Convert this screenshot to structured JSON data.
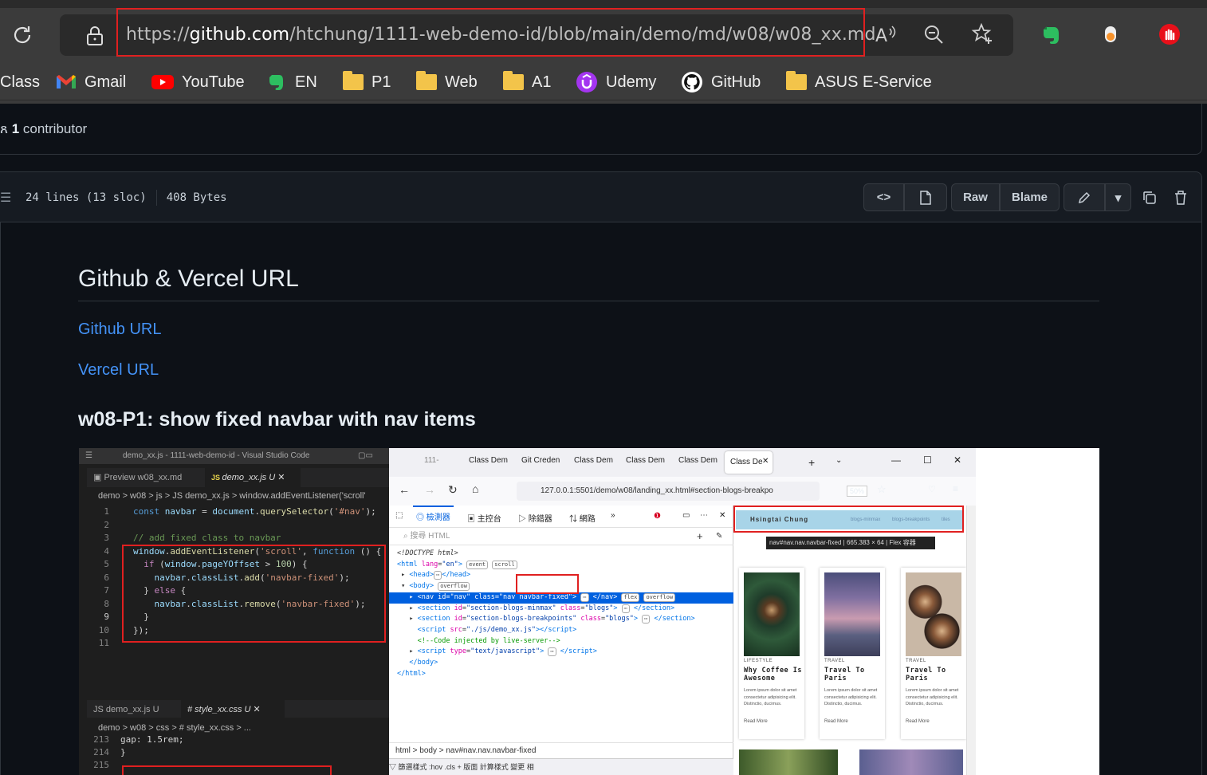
{
  "browser": {
    "url": {
      "prefix": "https://",
      "domain": "github.com",
      "path": "/htchung/1111-web-demo-id/blob/main/demo/md/w08/w08_xx.md"
    },
    "bookmarks": [
      {
        "label": "Class",
        "icon": "none"
      },
      {
        "label": "Gmail",
        "icon": "gmail-icon"
      },
      {
        "label": "YouTube",
        "icon": "youtube-icon"
      },
      {
        "label": "EN",
        "icon": "evernote-icon"
      },
      {
        "label": "P1",
        "icon": "folder-icon"
      },
      {
        "label": "Web",
        "icon": "folder-icon"
      },
      {
        "label": "A1",
        "icon": "folder-icon"
      },
      {
        "label": "Udemy",
        "icon": "udemy-icon"
      },
      {
        "label": "GitHub",
        "icon": "github-icon"
      },
      {
        "label": "ASUS E-Service",
        "icon": "folder-icon"
      }
    ]
  },
  "file": {
    "contributors": "1",
    "contributors_label": "contributor",
    "lines": "24 lines (13 sloc)",
    "size": "408 Bytes",
    "raw_label": "Raw",
    "blame_label": "Blame"
  },
  "markdown": {
    "h1": "Github & Vercel URL",
    "link1": "Github URL",
    "link2": "Vercel URL",
    "h3": "w08-P1: show fixed navbar with nav items"
  },
  "screenshot": {
    "vscode": {
      "title": "demo_xx.js - 1111-web-demo-id - Visual Studio Code",
      "tab1": "Preview w08_xx.md",
      "tab2": "demo_xx.js U",
      "breadcrumb": "demo > w08 > js > JS demo_xx.js > window.addEventListener('scroll'",
      "tab3": "JS demo_xx.js U",
      "tab4": "# style_xx.css U",
      "breadcrumb2": "demo > w08 > css > # style_xx.css > ...",
      "code2_213": "gap: 1.5rem;",
      "code2_214": "}"
    },
    "firefox": {
      "tabs": [
        "111-",
        "Class Dem",
        "Git Creden",
        "Class Dem",
        "Class Dem",
        "Class Dem",
        "Class De"
      ],
      "url": "127.0.0.1:5501/demo/w08/landing_xx.html#section-blogs-breakpo",
      "zoom": "50%",
      "devtools_tabs": [
        "檢測器",
        "主控台",
        "除錯器",
        "網路"
      ],
      "search_placeholder": "搜尋 HTML",
      "breadcrumb": "html > body > nav#nav.nav.navbar-fixed",
      "bottom_bar": "▽ 篩選樣式    :hov  .cls  +     版面   計算樣式   變更   相",
      "page": {
        "brand": "Hsingtai Chung",
        "nav_items": [
          "blogs-minmax",
          "blogs-breakpoints",
          "tiles"
        ],
        "tooltip": "nav#nav.nav.navbar-fixed | 665.383 × 64 | Flex 容器",
        "cards": [
          {
            "tag": "LIFESTYLE",
            "title": "Why Coffee Is Awesome",
            "text": "Lorem ipsum dolor sit amet consectetur adipisicing elit. Distinctio, ducimus.",
            "more": "Read More"
          },
          {
            "tag": "TRAVEL",
            "title": "Travel To Paris",
            "text": "Lorem ipsum dolor sit amet consectetur adipisicing elit. Distinctio, ducimus.",
            "more": "Read More"
          },
          {
            "tag": "TRAVEL",
            "title": "Travel To Paris",
            "text": "Lorem ipsum dolor sit amet consectetur adipisicing elit. Distinctio, ducimus.",
            "more": "Read More"
          }
        ]
      }
    }
  },
  "colors": {
    "accent_link": "#4493f8",
    "highlight_red": "#e02020",
    "github_bg": "#0d1117"
  }
}
